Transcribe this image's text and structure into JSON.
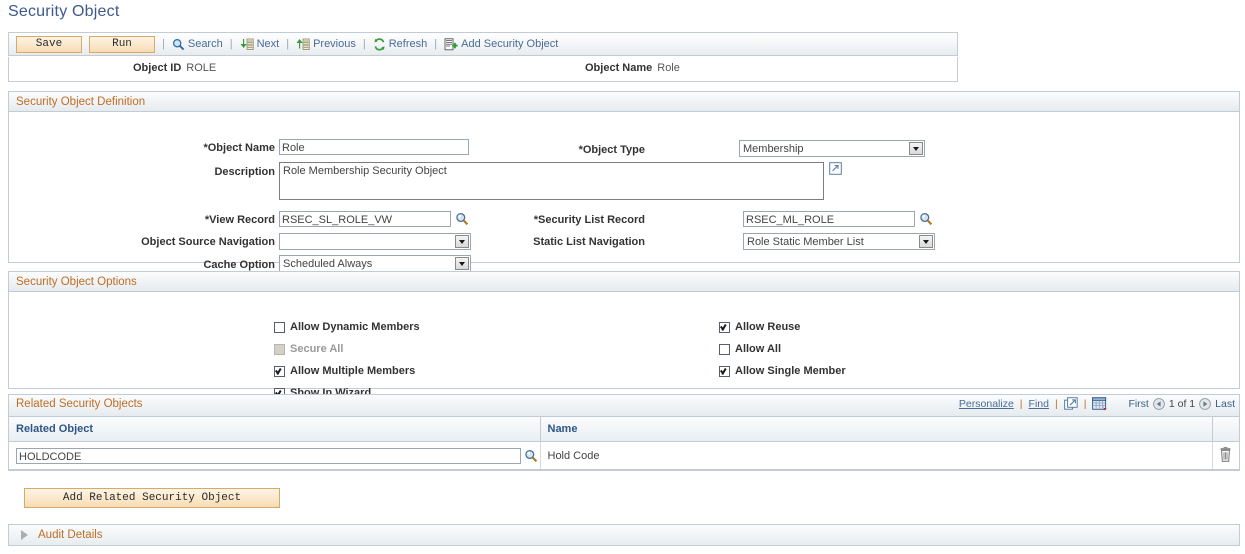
{
  "page": {
    "title": "Security Object"
  },
  "toolbar": {
    "save_label": "Save",
    "run_label": "Run",
    "sep": "|",
    "actions": [
      {
        "label": "Search",
        "icon": "search-icon"
      },
      {
        "label": "Next",
        "icon": "next-icon"
      },
      {
        "label": "Previous",
        "icon": "previous-icon"
      },
      {
        "label": "Refresh",
        "icon": "refresh-icon"
      },
      {
        "label": "Add Security Object",
        "icon": "add-document-icon"
      }
    ]
  },
  "keybar": {
    "object_id_label": "Object ID",
    "object_id_value": "ROLE",
    "object_name_label": "Object Name",
    "object_name_value": "Role"
  },
  "definition": {
    "header": "Security Object Definition",
    "object_name_label": "*Object Name",
    "object_name_value": "Role",
    "object_type_label": "*Object Type",
    "object_type_value": "Membership",
    "description_label": "Description",
    "description_value": "Role Membership Security Object",
    "view_record_label": "*View Record",
    "view_record_value": "RSEC_SL_ROLE_VW",
    "security_list_record_label": "*Security List Record",
    "security_list_record_value": "RSEC_ML_ROLE",
    "object_source_nav_label": "Object Source Navigation",
    "object_source_nav_value": "",
    "static_list_nav_label": "Static List Navigation",
    "static_list_nav_value": "Role Static Member List",
    "cache_option_label": "Cache Option",
    "cache_option_value": "Scheduled Always"
  },
  "options": {
    "header": "Security Object Options",
    "left": [
      {
        "label": "Allow Dynamic Members",
        "checked": false,
        "disabled": false
      },
      {
        "label": "Secure All",
        "checked": false,
        "disabled": true
      },
      {
        "label": "Allow Multiple Members",
        "checked": true,
        "disabled": false
      },
      {
        "label": "Show In Wizard",
        "checked": true,
        "disabled": false
      }
    ],
    "right": [
      {
        "label": "Allow Reuse",
        "checked": true,
        "disabled": false
      },
      {
        "label": "Allow All",
        "checked": false,
        "disabled": false
      },
      {
        "label": "Allow Single Member",
        "checked": true,
        "disabled": false
      }
    ]
  },
  "related": {
    "header": "Related Security Objects",
    "personalize_label": "Personalize",
    "find_label": "Find",
    "separator": "|",
    "view_all_icon": "expand-grid-icon",
    "download_icon": "download-to-excel-icon",
    "first_label": "First",
    "last_label": "Last",
    "page_count": "1 of 1",
    "columns": [
      "Related Object",
      "Name"
    ],
    "rows": [
      {
        "related_object": "HOLDCODE",
        "name": "Hold Code",
        "lookup_icon": "lookup-magnifier-icon",
        "delete_icon": "trash-icon"
      }
    ],
    "add_button_label": "Add Related Security Object"
  },
  "audit": {
    "label": "Audit Details"
  },
  "colors": {
    "title": "#3d5a8a",
    "section_header_text": "#c06d21",
    "link": "#4a6c95",
    "column_header_text": "#2e5685",
    "button_face": "#fbe8cc",
    "button_border": "#d8a967",
    "panel_border": "#c3ccd4"
  }
}
